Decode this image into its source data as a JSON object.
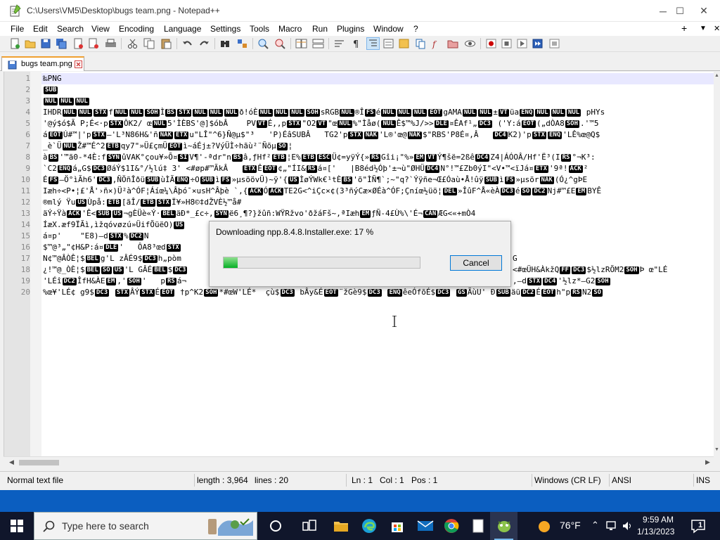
{
  "window": {
    "title": "C:\\Users\\VM5\\Desktop\\bugs team.png - Notepad++",
    "minimize": "─",
    "maximize": "☐",
    "close": "✕"
  },
  "menu": [
    "File",
    "Edit",
    "Search",
    "View",
    "Encoding",
    "Language",
    "Settings",
    "Tools",
    "Macro",
    "Run",
    "Plugins",
    "Window",
    "?"
  ],
  "menu_right": {
    "plus": "+",
    "chevron": "▼",
    "close": "✕"
  },
  "tab": {
    "label": "bugs team.png"
  },
  "editor": {
    "line_numbers": [
      "1",
      "2",
      "3",
      "4",
      "5",
      "6",
      "7",
      "8",
      "9",
      "10",
      "11",
      "12",
      "13",
      "14",
      "15",
      "16",
      "17",
      "18",
      "19",
      "20"
    ],
    "lines": [
      [
        {
          "t": "‰PNG"
        }
      ],
      [
        {
          "c": "SUB"
        }
      ],
      [
        {
          "c": "NUL"
        },
        {
          "c": "NUL"
        },
        {
          "c": "NUL"
        }
      ],
      [
        {
          "t": "IHDR"
        },
        {
          "c": "NUL"
        },
        {
          "c": "NUL"
        },
        {
          "c": "STX"
        },
        {
          "t": "f"
        },
        {
          "c": "NUL"
        },
        {
          "c": "NUL"
        },
        {
          "c": "SOH"
        },
        {
          "t": "Ì"
        },
        {
          "c": "BS"
        },
        {
          "c": "STX"
        },
        {
          "c": "NUL"
        },
        {
          "c": "NUL"
        },
        {
          "c": "NUL"
        },
        {
          "t": "ð!óÈ"
        },
        {
          "c": "NUL"
        },
        {
          "c": "NUL"
        },
        {
          "c": "NUL"
        },
        {
          "c": "SOH"
        },
        {
          "t": "sRGB"
        },
        {
          "c": "NUL"
        },
        {
          "t": "®Î"
        },
        {
          "c": "FS"
        },
        {
          "t": "é"
        },
        {
          "c": "NUL"
        },
        {
          "c": "NUL"
        },
        {
          "c": "NUL"
        },
        {
          "c": "EOT"
        },
        {
          "t": "gAMA"
        },
        {
          "c": "NUL"
        },
        {
          "c": "NUL"
        },
        {
          "t": "±"
        },
        {
          "c": "VT"
        },
        {
          "t": "üa"
        },
        {
          "c": "ENQ"
        },
        {
          "c": "NUL"
        },
        {
          "c": "NUL"
        },
        {
          "c": "NUL"
        },
        {
          "t": " pHYs"
        }
      ],
      [
        {
          "t": "'@ý$ó$Ã P;É<·p"
        },
        {
          "c": "STX"
        },
        {
          "t": "ÔK2/ œ"
        },
        {
          "c": "NUL"
        },
        {
          "t": "5'ÌÈBS'@]$óbÂ    PV"
        },
        {
          "c": "VT"
        },
        {
          "t": "É,,p"
        },
        {
          "c": "STX"
        },
        {
          "t": "\"O2"
        },
        {
          "c": "VT"
        },
        {
          "t": "\"œ"
        },
        {
          "c": "NUL"
        },
        {
          "t": "%\"Ìåø("
        },
        {
          "c": "NUL"
        },
        {
          "t": "Ê$™%J/>>"
        },
        {
          "c": "DLE"
        },
        {
          "t": "¤ÊAf¹„"
        },
        {
          "c": "DC3"
        },
        {
          "t": " ('Y:á"
        },
        {
          "c": "EOT"
        },
        {
          "t": "(„dÒA8"
        },
        {
          "c": "SOH"
        },
        {
          "t": ".'™5"
        }
      ],
      [
        {
          "t": "á"
        },
        {
          "c": "EOT"
        },
        {
          "t": "Ú#™|'p"
        },
        {
          "c": "STX"
        },
        {
          "t": "–'L³N86H&'ñ"
        },
        {
          "c": "NAK"
        },
        {
          "c": "ETX"
        },
        {
          "t": "u\"LÎ\"^6}Ñ@µ$\"³   'P)ÉâSUBÂ   TG2'p"
        },
        {
          "c": "STX"
        },
        {
          "c": "NAK"
        },
        {
          "t": "'L®'œ@"
        },
        {
          "c": "NAK"
        },
        {
          "t": "$\"RBS'P8É¤,Â   "
        },
        {
          "c": "DC4"
        },
        {
          "t": "K2)'p"
        },
        {
          "c": "STX"
        },
        {
          "c": "ENQ"
        },
        {
          "t": "'LÊ%œ@Q$"
        }
      ],
      [
        {
          "t": "_è`Ü"
        },
        {
          "c": "NUL"
        },
        {
          "t": "Ž#™É^2"
        },
        {
          "c": "ETB"
        },
        {
          "t": "qy7\"»Ü£çmÜ"
        },
        {
          "c": "EOT"
        },
        {
          "t": "ì~áÉj±?VýÜÌ÷hãù²¨Ñõµ"
        },
        {
          "c": "SO"
        },
        {
          "t": "¦"
        }
      ],
      [
        {
          "t": "à"
        },
        {
          "c": "BS"
        },
        {
          "t": "'™ã0-*4È:f"
        },
        {
          "c": "SYN"
        },
        {
          "t": "ûVAK°çou¥»Õ¤"
        },
        {
          "c": "SI"
        },
        {
          "t": "V¶'-ªdr\"n"
        },
        {
          "c": "BS"
        },
        {
          "t": "â,ƒHf²"
        },
        {
          "c": "ETB"
        },
        {
          "t": "¦E%"
        },
        {
          "c": "ETB"
        },
        {
          "c": "ESC"
        },
        {
          "t": "Ü¢=yÿÝ{»"
        },
        {
          "c": "RS"
        },
        {
          "t": "Gîi¡\"%»"
        },
        {
          "c": "EM"
        },
        {
          "c": "VT"
        },
        {
          "t": "Ý¶šë=2ßê"
        },
        {
          "c": "DC4"
        },
        {
          "t": "Z4|ÁÓOÂ/Hf'Ë³(I"
        },
        {
          "c": "RS"
        },
        {
          "t": "°¬K³:"
        }
      ],
      [
        {
          "t": "`C2"
        },
        {
          "c": "ENQ"
        },
        {
          "t": "á„G$"
        },
        {
          "c": "DC3"
        },
        {
          "t": "ØáÝ$1I&°/½lú‡ 3' <#øp#™ÃkÂ   "
        },
        {
          "c": "ETX"
        },
        {
          "t": "Ê"
        },
        {
          "c": "EOT"
        },
        {
          "t": "¢„\"ÍI&"
        },
        {
          "c": "RS"
        },
        {
          "t": "á¤['   |B8éd½Óþ'±¬ù\"ØHÜ"
        },
        {
          "c": "DC4"
        },
        {
          "t": "N°!™£Zb0ýI\"<V•™<ïJá¤"
        },
        {
          "c": "ETX"
        },
        {
          "t": "'9ª!"
        },
        {
          "c": "ACK"
        },
        {
          "t": "²"
        }
      ],
      [
        {
          "t": "É"
        },
        {
          "c": "FS"
        },
        {
          "t": "–Ö°ìÃh6'"
        },
        {
          "c": "DC3"
        },
        {
          "t": ",ÑÖñÎðü"
        },
        {
          "c": "SUB"
        },
        {
          "t": "ùÌÃ"
        },
        {
          "c": "ENQ"
        },
        {
          "t": "÷O"
        },
        {
          "c": "SUB"
        },
        {
          "t": "ì"
        },
        {
          "c": "FS"
        },
        {
          "t": "»µsöövÜ)~ÿ'{"
        },
        {
          "c": "US"
        },
        {
          "t": "ÌøÝWk€¹tÈ"
        },
        {
          "c": "BS"
        },
        {
          "t": "'õ\"ÌÑ¶`;~\"q?`Ýÿñe¬Œ£Óaù•Å!ûÿ"
        },
        {
          "c": "SUB"
        },
        {
          "t": "ì"
        },
        {
          "c": "FS"
        },
        {
          "t": "»µsör"
        },
        {
          "c": "NAK"
        },
        {
          "t": "(Ó¿^gÞE"
        }
      ],
      [
        {
          "t": "Iæh÷<P•¦£'Å'›ñ×)Ü²à^ÓF¦Áíœ¼\\Âþó¯×usH^Âþè `,{"
        },
        {
          "c": "ACK"
        },
        {
          "t": "Ó"
        },
        {
          "c": "ACK"
        },
        {
          "t": "TE2G<^iÇc×¢(3³ñýCæ×ØÉà^ÓF;Çníœ½üö¦"
        },
        {
          "c": "DEL"
        },
        {
          "t": "»ÎûF^Å«èÀ"
        },
        {
          "c": "DC3"
        },
        {
          "t": "é"
        },
        {
          "c": "SO"
        },
        {
          "c": "DC2"
        },
        {
          "t": "Nj#™£E"
        },
        {
          "c": "EM"
        },
        {
          "t": "BYÊ"
        }
      ],
      [
        {
          "t": "®mlý Ÿu"
        },
        {
          "c": "US"
        },
        {
          "t": "Ùpå:"
        },
        {
          "c": "ETB"
        },
        {
          "t": "[ãÎ/"
        },
        {
          "c": "ETB"
        },
        {
          "c": "STX"
        },
        {
          "t": "Ï¥»H8©‡dŽVÈ½™å#"
        }
      ],
      [
        {
          "t": "äÝ÷Ÿà"
        },
        {
          "c": "ACK"
        },
        {
          "t": "'Ê<"
        },
        {
          "c": "SUB"
        },
        {
          "c": "US"
        },
        {
          "t": "¬gÈÜè«Ý·"
        },
        {
          "c": "BEL"
        },
        {
          "t": "äÐ*_£c÷,"
        },
        {
          "c": "SYN"
        },
        {
          "t": "ë6¸¶?}žûñ:WŸRžvo'ðžáFš~,ªIæh"
        },
        {
          "c": "EM"
        },
        {
          "t": "ƒÑ-4£Ù%\\'É¬"
        },
        {
          "c": "CAN"
        },
        {
          "t": "ÆG<«+mÒ4"
        }
      ],
      [
        {
          "t": "ÍæX.æf9ÏÃì,ìžqóvøzú»ÜifÕüëO)"
        },
        {
          "c": "US"
        }
      ],
      [
        {
          "t": "á¤p'    \"E8)–d"
        },
        {
          "c": "STX"
        },
        {
          "t": "%"
        },
        {
          "c": "DC2"
        },
        {
          "t": "N"
        }
      ],
      [
        {
          "t": "$™@³„\"¢H&P:á¤"
        },
        {
          "c": "DLE"
        },
        {
          "t": "'   ÔA8³œd"
        },
        {
          "c": "STX"
        }
      ],
      [
        {
          "t": "N¢™@ÂÒÊ¦$"
        },
        {
          "c": "BEL"
        },
        {
          "t": "g'L zÂÉ9$"
        },
        {
          "c": "DC3"
        },
        {
          "t": "h„pòm"
        }
      ],
      [
        {
          "t": "¿!™@_ÒÈ¦$"
        },
        {
          "c": "BEL"
        },
        {
          "c": "SO"
        },
        {
          "c": "US"
        },
        {
          "t": "'L GÂÉ"
        },
        {
          "c": "BEL"
        },
        {
          "t": "$"
        },
        {
          "c": "DC3"
        }
      ],
      [
        {
          "t": "'LÉî"
        },
        {
          "c": "DC2"
        },
        {
          "t": "ÎfH&ÀE"
        },
        {
          "c": "EM"
        },
        {
          "t": ",'"
        },
        {
          "c": "SOH"
        },
        {
          "t": "'   p"
        },
        {
          "c": "RS"
        },
        {
          "t": "á¬"
        }
      ],
      [
        {
          "t": "%œ¥'LÉ¢ g9$"
        },
        {
          "c": "DC3"
        },
        {
          "t": " "
        },
        {
          "c": "STX"
        },
        {
          "t": "ÂÝ"
        },
        {
          "c": "STX"
        },
        {
          "t": "É"
        },
        {
          "c": "EOT"
        },
        {
          "t": " †p^K2"
        },
        {
          "c": "SOH"
        },
        {
          "t": "*#œW'LÉ*  çù$"
        },
        {
          "c": "DC3"
        },
        {
          "t": " bÂy&É"
        },
        {
          "c": "EOT"
        },
        {
          "t": "¨žGè9$"
        },
        {
          "c": "DC3"
        },
        {
          "t": " "
        },
        {
          "c": "ENQ"
        },
        {
          "t": "êeÓfõÉ$"
        },
        {
          "c": "DC3"
        },
        {
          "t": " "
        },
        {
          "c": "GS"
        },
        {
          "t": "ÃùU' Ð"
        },
        {
          "c": "SUB"
        },
        {
          "t": "äü"
        },
        {
          "c": "DC2"
        },
        {
          "t": "É"
        },
        {
          "c": "EOT"
        },
        {
          "t": "h\"p"
        },
        {
          "c": "RS"
        },
        {
          "t": "N2"
        },
        {
          "c": "SO"
        }
      ]
    ],
    "line_tails": {
      "17": "G",
      "18": "<#œÜH&ÀkžQ",
      "18b": "$½lzRÕM2",
      "18c": "Þ œ\"LÉ",
      "19": ",–d",
      "19b": "'½lz*–G2"
    },
    "tail_codes": {
      "18a": "FF",
      "18b": "DC3",
      "18c": "SOH",
      "19a": "STX",
      "19b": "DC4",
      "19c": "SOH"
    }
  },
  "dialog": {
    "message": "Downloading npp.8.4.8.Installer.exe: 17 %",
    "progress": 0.07,
    "cancel_label": "Cancel"
  },
  "status": {
    "file_type": "Normal text file",
    "length": "length : 3,964",
    "lines": "lines : 20",
    "ln": "Ln : 1",
    "col": "Col : 1",
    "pos": "Pos : 1",
    "eol": "Windows (CR LF)",
    "encoding": "ANSI",
    "mode": "INS"
  },
  "taskbar": {
    "search_placeholder": "Type here to search",
    "weather": "76°F",
    "time": "9:59 AM",
    "date": "1/13/2023",
    "notification_count": "1"
  },
  "colors": {
    "accent": "#0078d7",
    "progress_green": "#06b025",
    "tab_accent": "#f0a030",
    "taskbar": "#10162b"
  }
}
